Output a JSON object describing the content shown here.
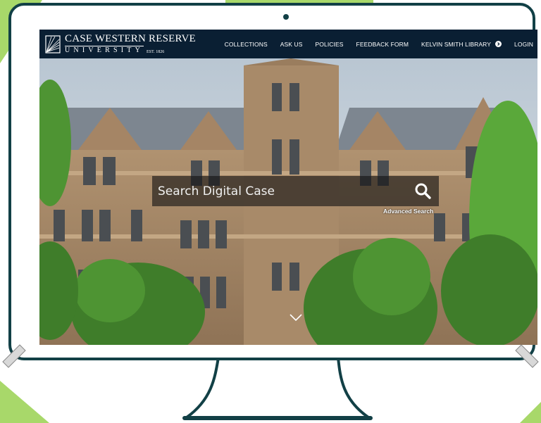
{
  "header": {
    "logo_name": "CASE WESTERN RESERVE",
    "logo_university": "UNIVERSITY",
    "logo_est": "EST. 1826"
  },
  "nav": {
    "items": [
      {
        "label": "COLLECTIONS"
      },
      {
        "label": "ASK US"
      },
      {
        "label": "POLICIES"
      },
      {
        "label": "FEEDBACK FORM"
      },
      {
        "label": "KELVIN SMITH LIBRARY"
      },
      {
        "label": "LOGIN"
      }
    ]
  },
  "search": {
    "placeholder": "Search Digital Case",
    "advanced_label": "Advanced Search"
  },
  "colors": {
    "monitor_frame": "#124046",
    "navbar": "#0a1f33",
    "accent_green": "#a8d86a"
  }
}
